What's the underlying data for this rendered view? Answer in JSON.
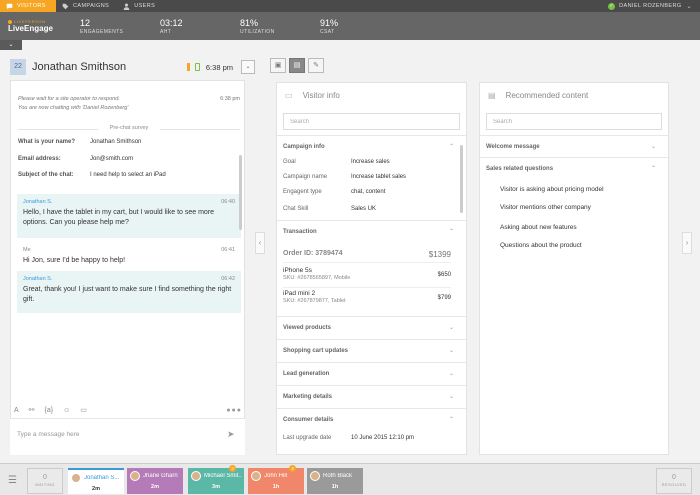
{
  "nav": {
    "tabs": [
      {
        "label": "VISITORS",
        "icon": "chat-bubble-icon"
      },
      {
        "label": "CAMPAIGNS",
        "icon": "tag-icon"
      },
      {
        "label": "USERS",
        "icon": "user-icon"
      }
    ],
    "user": {
      "name": "DANIEL ROZENBERG",
      "status_color": "#7ac143"
    }
  },
  "brand": {
    "sub": "LIVEPERSON",
    "name": "LiveEngage"
  },
  "stats": [
    {
      "value": "12",
      "label": "ENGAGEMENTS"
    },
    {
      "value": "03:12",
      "label": "AHT"
    },
    {
      "value": "81%",
      "label": "UTILIZATION"
    },
    {
      "value": "91%",
      "label": "CSAT"
    }
  ],
  "chat": {
    "badge": "22",
    "visitor_name": "Jonathan Smithson",
    "time": "6:38 pm",
    "system_messages": [
      "Please wait for a site operator to respond.",
      "You are now chatting with 'Daniel Rozenberg'"
    ],
    "system_time": "6:38 pm",
    "survey_title": "Pre-chat survey",
    "survey": [
      {
        "q": "What is your name?",
        "a": "Jonathan Smithson"
      },
      {
        "q": "Email address:",
        "a": "Jon@smith.com"
      },
      {
        "q": "Subject of the chat:",
        "a": "I need help to select an iPad"
      }
    ],
    "messages": [
      {
        "from": "Jonathan S.",
        "time": "06:40",
        "text": "Hello, I have the tablet in my cart, but I would like to see more options. Can you please help me?"
      },
      {
        "from": "Me",
        "time": "06:41",
        "text": "Hi Jon, sure I'd be happy to help!"
      },
      {
        "from": "Jonathan S.",
        "time": "06:42",
        "text": "Great, thank you! I just want to make sure I find something the right gift."
      }
    ],
    "composer_placeholder": "Type a message here"
  },
  "visitor_info": {
    "title": "Visitor info",
    "search_placeholder": "Search",
    "campaign_header": "Campaign info",
    "campaign": [
      {
        "k": "Goal",
        "v": "Increase sales"
      },
      {
        "k": "Campaign name",
        "v": "Increase tablet sales"
      },
      {
        "k": "Engagent type",
        "v": "chat, content"
      },
      {
        "k": "Chat Skill",
        "v": "Sales UK"
      }
    ],
    "transaction_header": "Transaction",
    "order_id": "Order ID: 3789474",
    "order_total": "$1399",
    "items": [
      {
        "name": "iPhone 5s",
        "sku": "SKU: #2678565897, Mobile",
        "price": "$650"
      },
      {
        "name": "iPad mini 2",
        "sku": "SKU: #267879877, Tablet",
        "price": "$799"
      }
    ],
    "sections": [
      "Viewed products",
      "Shopping cart updates",
      "Lead generation",
      "Marketing details"
    ],
    "consumer_header": "Consumer details",
    "consumer": [
      {
        "k": "Last upgrade date",
        "v": "10 June 2015 12:10 pm"
      }
    ]
  },
  "recommended": {
    "title": "Recommended content",
    "search_placeholder": "Search",
    "welcome": "Welcome message",
    "sales": "Sales related questions",
    "questions": [
      "Visitor is asking about pricing model",
      "Visitor mentions other company",
      "Asking about new features",
      "Questions about the product"
    ]
  },
  "bottom": {
    "waiting": {
      "count": "0",
      "label": "WAITING"
    },
    "tabs": [
      {
        "name": "Jonathan S...",
        "time": "2m",
        "badge": ""
      },
      {
        "name": "Jhane Gharn",
        "time": "2m",
        "badge": ""
      },
      {
        "name": "Michael Smit...",
        "time": "3m",
        "badge": "3"
      },
      {
        "name": "John Hill",
        "time": "1h",
        "badge": "3"
      },
      {
        "name": "Roth Black",
        "time": "1h",
        "badge": ""
      }
    ],
    "resolved": {
      "count": "0",
      "label": "RESOLVED"
    }
  }
}
